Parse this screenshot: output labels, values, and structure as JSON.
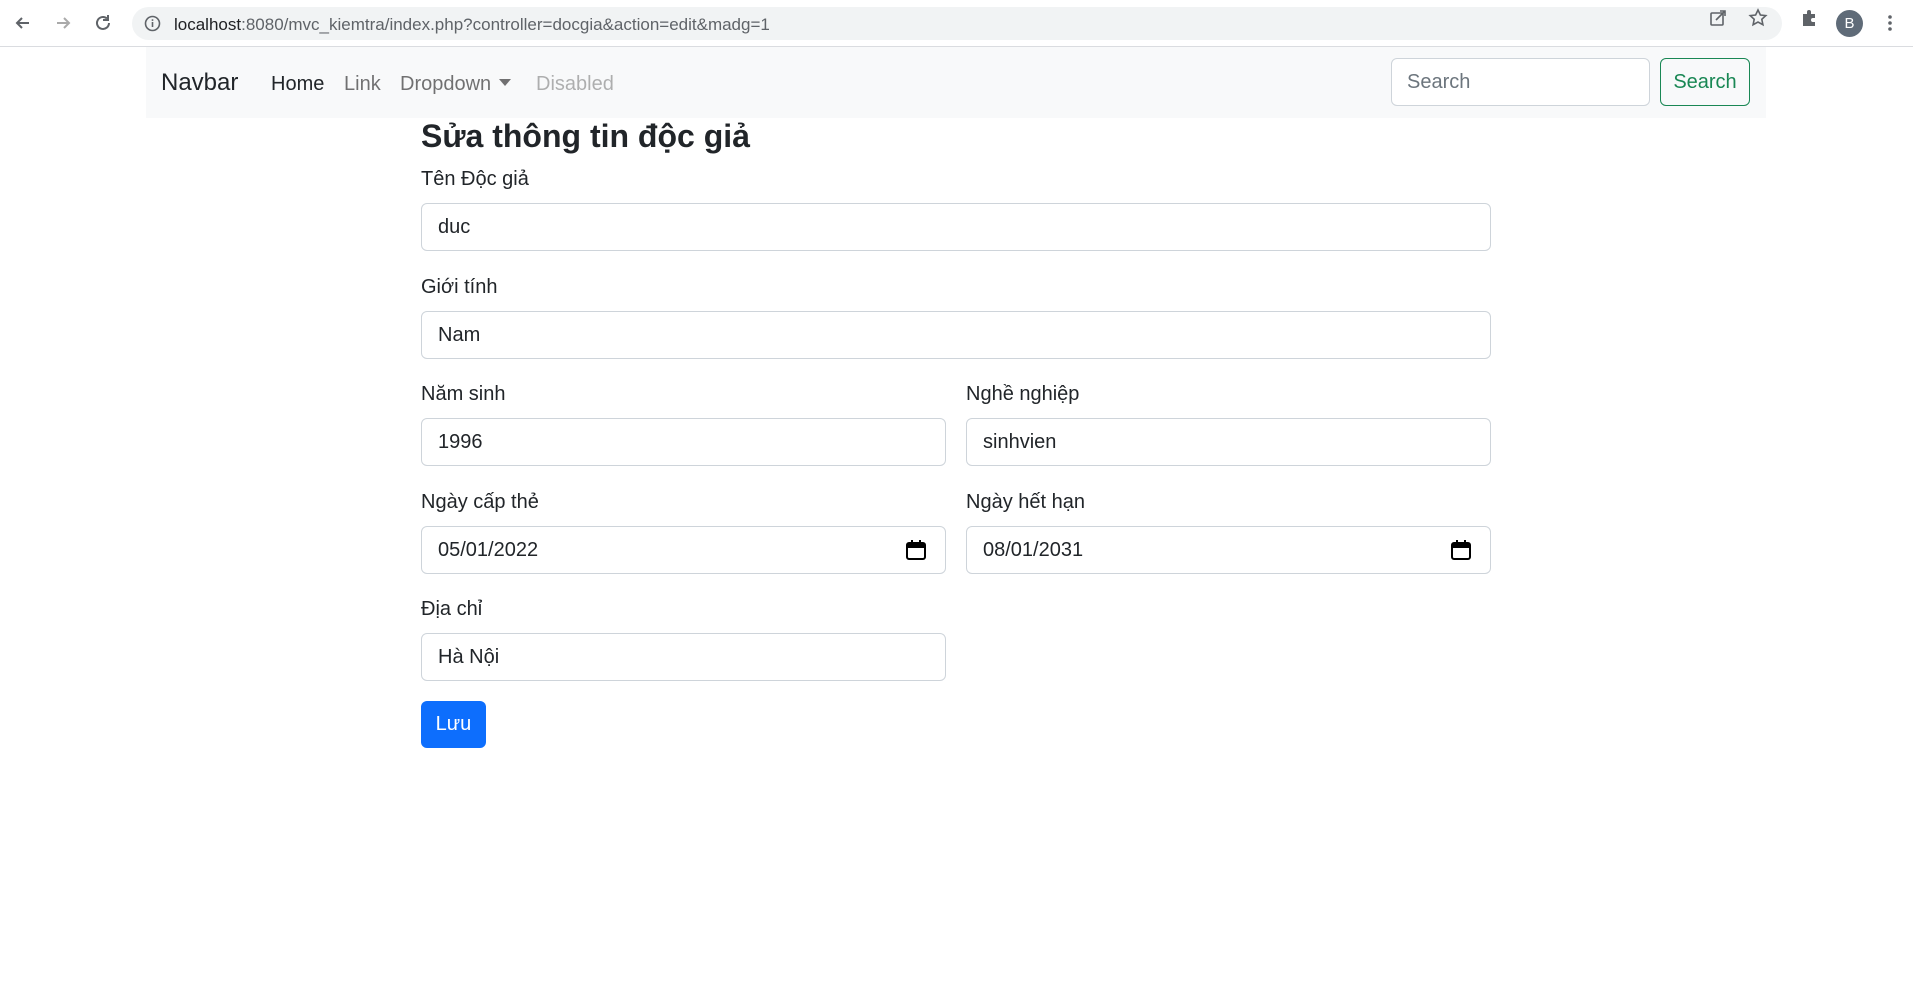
{
  "browser": {
    "url_host": "localhost",
    "url_path": ":8080/mvc_kiemtra/index.php?controller=docgia&action=edit&madg=1",
    "profile_initial": "B"
  },
  "navbar": {
    "brand": "Navbar",
    "links": [
      {
        "label": "Home",
        "state": "active"
      },
      {
        "label": "Link",
        "state": "normal"
      },
      {
        "label": "Dropdown",
        "state": "dropdown"
      },
      {
        "label": "Disabled",
        "state": "disabled"
      }
    ],
    "search_placeholder": "Search",
    "search_button": "Search"
  },
  "form": {
    "title": "Sửa thông tin độc giả",
    "ten_label": "Tên Độc giả",
    "ten_value": "duc",
    "gioitinh_label": "Giới tính",
    "gioitinh_value": "Nam",
    "namsinh_label": "Năm sinh",
    "namsinh_value": "1996",
    "nghenghiep_label": "Nghề nghiệp",
    "nghenghiep_value": "sinhvien",
    "ngaycap_label": "Ngày cấp thẻ",
    "ngaycap_value": "05/01/2022",
    "ngayhethan_label": "Ngày hết hạn",
    "ngayhethan_value": "08/01/2031",
    "diachi_label": "Địa chỉ",
    "diachi_value": "Hà Nội",
    "save_button": "Lưu"
  },
  "colors": {
    "primary": "#0d6efd",
    "success": "#198754",
    "navbar_bg": "#f8f9fa"
  }
}
